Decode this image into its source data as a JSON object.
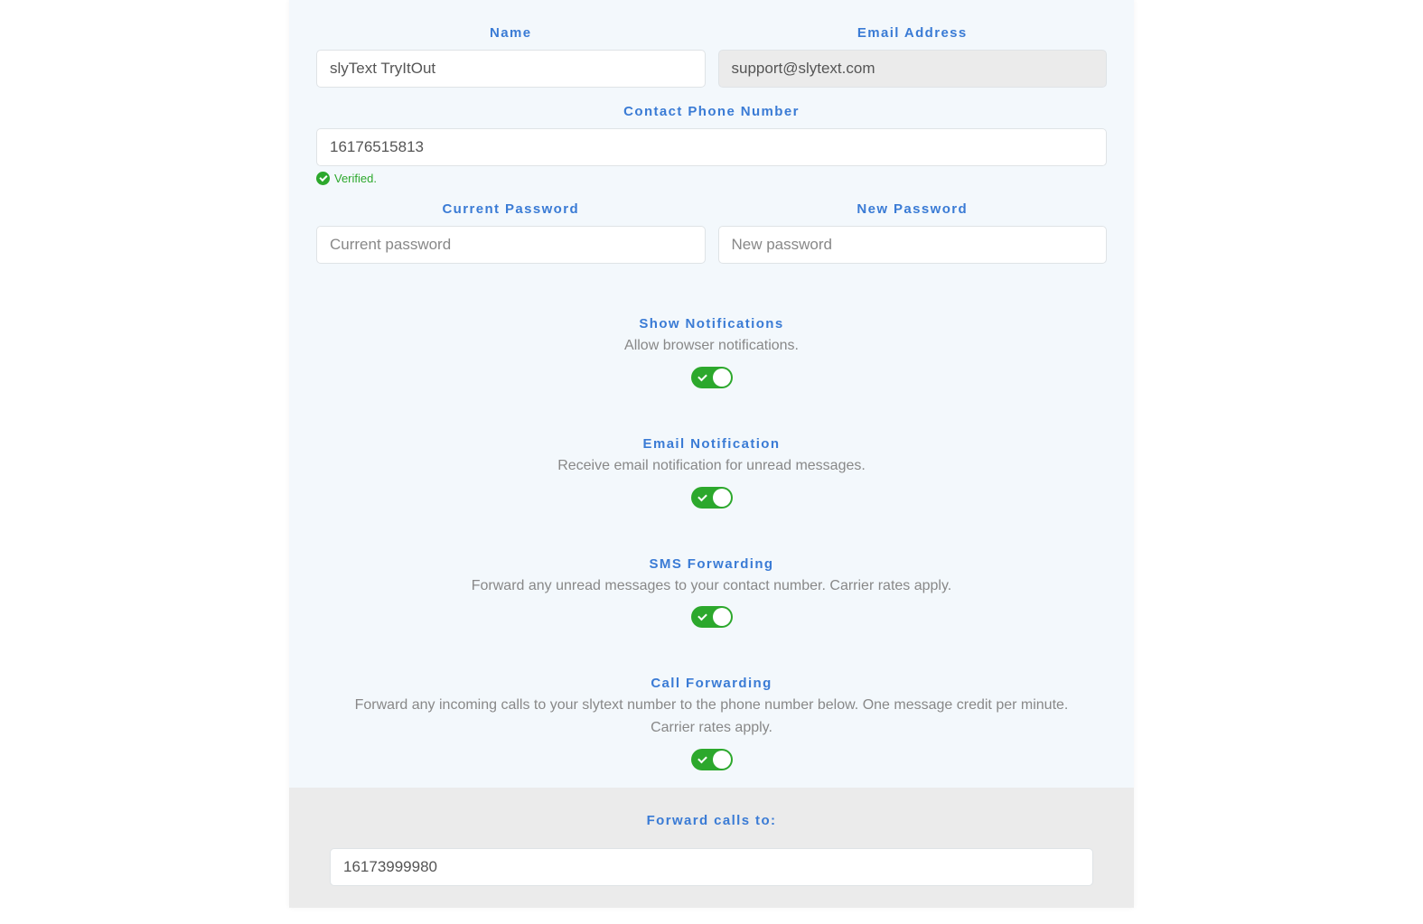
{
  "labels": {
    "name": "Name",
    "email": "Email Address",
    "contact_phone": "Contact Phone Number",
    "current_password": "Current Password",
    "new_password": "New Password",
    "show_notifications": "Show Notifications",
    "email_notification": "Email Notification",
    "sms_forwarding": "SMS Forwarding",
    "call_forwarding": "Call Forwarding",
    "forward_calls_to": "Forward calls to:"
  },
  "values": {
    "name": "slyText TryItOut",
    "email": "support@slytext.com",
    "contact_phone": "16176515813",
    "forward_number": "16173999980"
  },
  "placeholders": {
    "current_password": "Current password",
    "new_password": "New password"
  },
  "verified_text": "Verified.",
  "descriptions": {
    "show_notifications": "Allow browser notifications.",
    "email_notification": "Receive email notification for unread messages.",
    "sms_forwarding": "Forward any unread messages to your contact number. Carrier rates apply.",
    "call_forwarding": "Forward any incoming calls to your slytext number to the phone number below. One message credit per minute. Carrier rates apply."
  }
}
